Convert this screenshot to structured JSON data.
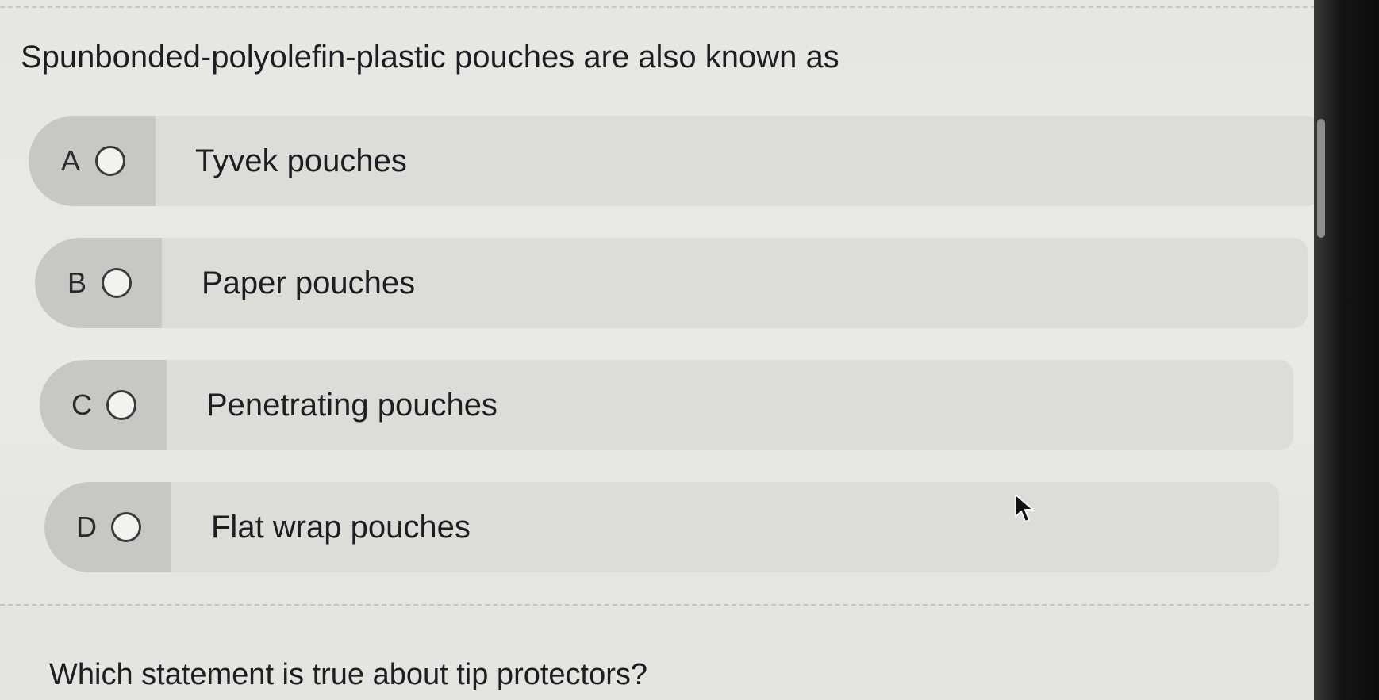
{
  "question": {
    "text": "Spunbonded-polyolefin-plastic pouches are also known as",
    "options": [
      {
        "letter": "A",
        "label": "Tyvek pouches"
      },
      {
        "letter": "B",
        "label": "Paper pouches"
      },
      {
        "letter": "C",
        "label": "Penetrating pouches"
      },
      {
        "letter": "D",
        "label": "Flat wrap pouches"
      }
    ]
  },
  "next_question": {
    "text": "Which statement is true about tip protectors?"
  },
  "icons": {
    "radio": "radio-unselected-icon",
    "cursor": "mouse-pointer-icon"
  },
  "colors": {
    "page_background": "#e6e6e2",
    "option_background": "#dcdcd8",
    "option_tab": "#c7c7c3",
    "text": "#1e1e22",
    "bezel": "#111111"
  }
}
